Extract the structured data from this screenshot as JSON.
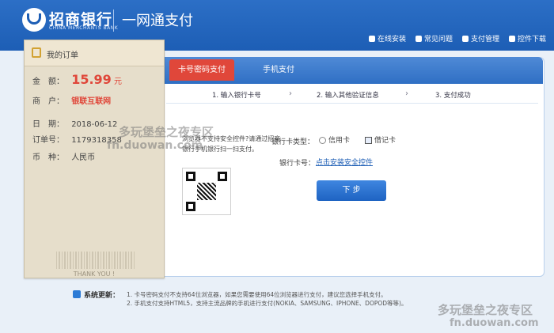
{
  "header": {
    "bank_name": "招商银行",
    "bank_name_en": "CHINA MERCHANTS BANK",
    "slogan": "一网通支付",
    "nav": [
      {
        "label": "在线安装"
      },
      {
        "label": "常见问题"
      },
      {
        "label": "支付管理"
      },
      {
        "label": "控件下载"
      }
    ]
  },
  "receipt": {
    "title": "我的订单",
    "amount_label": "金　额：",
    "amount": "15.99",
    "unit": "元",
    "merchant_label": "商　户：",
    "merchant": "银联互联网",
    "date_label": "日　期：",
    "date": "2018-06-12",
    "order_label": "订单号：",
    "order_no": "1179318358",
    "currency_label": "币　种：",
    "currency": "人民币",
    "thanks": "THANK YOU !"
  },
  "tabs": {
    "card_pay": "卡号密码支付",
    "mobile_pay": "手机支付"
  },
  "steps": [
    {
      "label": "1. 输入银行卡号"
    },
    {
      "label": "2. 输入其他验证信息"
    },
    {
      "label": "3. 支付成功"
    }
  ],
  "form": {
    "ie_note": "浏览器不支持安全控件?请通过招商银行手机银行扫一扫支付。",
    "card_type_label": "银行卡类型：",
    "credit_label": "信用卡",
    "debit_label": "借记卡",
    "card_no_label": "银行卡号：",
    "install_link": "点击安装安全控件",
    "next_button": "下 步"
  },
  "system_update": {
    "title": "系统更新：",
    "lines": [
      "1. 卡号密码支付不支持64位浏览器，如果您需要使用64位浏览器进行支付，建议您选择手机支付。",
      "2. 手机支付支持HTML5，支持主流品牌的手机进行支付(NOKIA、SAMSUNG、IPHONE、DOPOD等等)。"
    ]
  },
  "watermarks": {
    "top": "多玩堡垒之夜专区",
    "top_url": "fn.duowan.com",
    "bottom": "多玩堡垒之夜专区",
    "bottom_url": "fn.duowan.com"
  }
}
